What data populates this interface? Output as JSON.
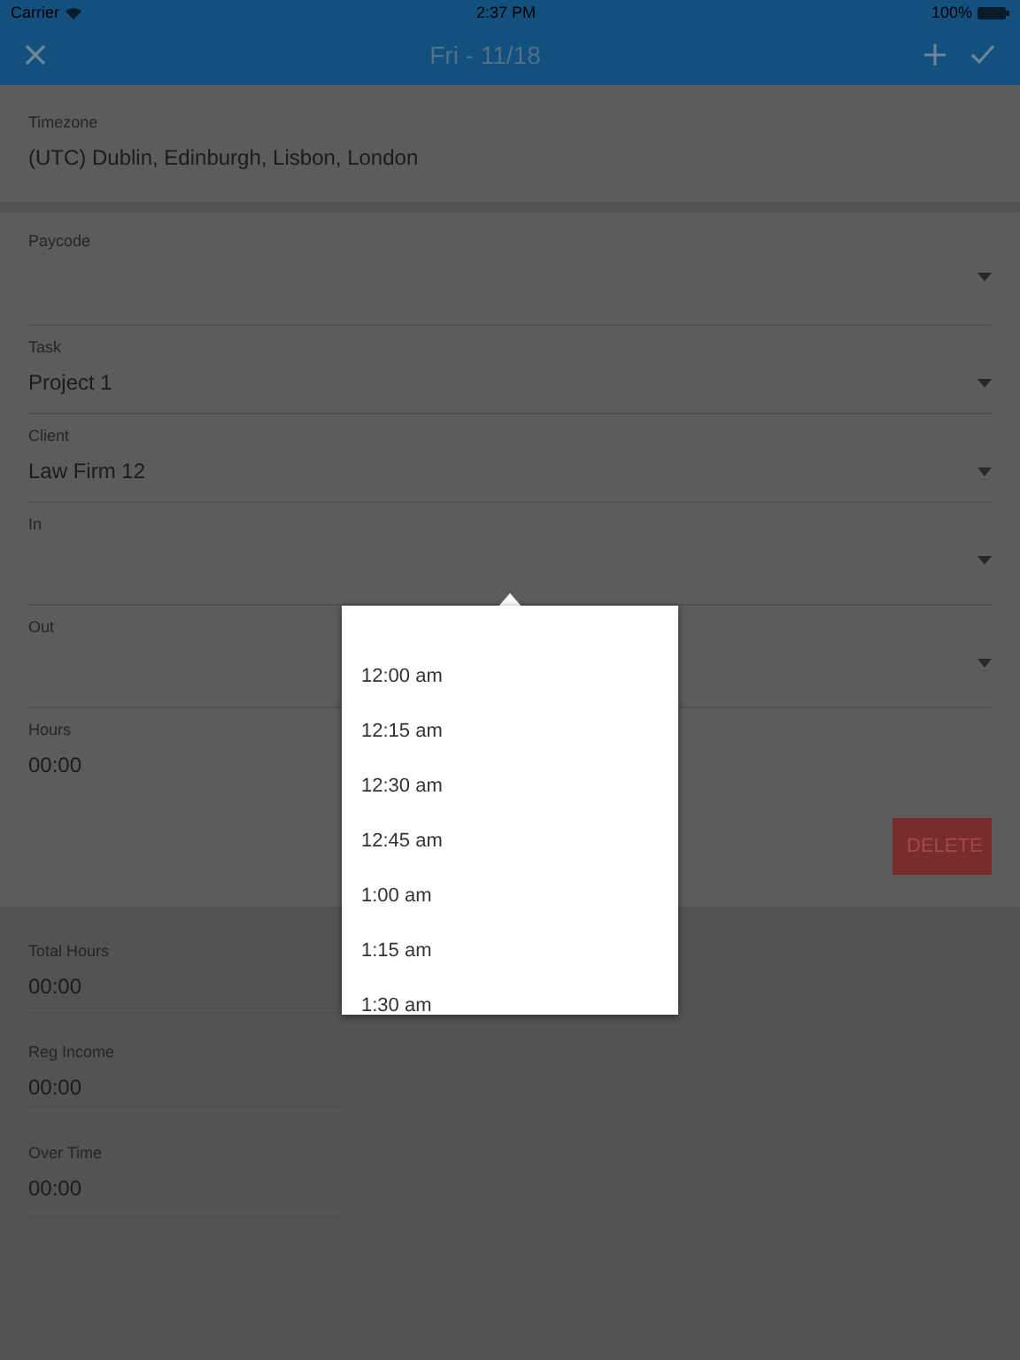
{
  "status_bar": {
    "carrier": "Carrier",
    "time": "2:37 PM",
    "battery": "100%"
  },
  "header": {
    "title": "Fri - 11/18"
  },
  "timezone": {
    "label": "Timezone",
    "value": "(UTC) Dublin, Edinburgh, Lisbon, London"
  },
  "fields": [
    {
      "kind": "select",
      "label": "Paycode"
    },
    {
      "kind": "select",
      "label": "Task",
      "value": "Project 1"
    },
    {
      "kind": "select",
      "label": "Client",
      "value": "Law Firm 12"
    },
    {
      "kind": "select",
      "label": "In"
    },
    {
      "kind": "select",
      "label": "Out"
    },
    {
      "kind": "text",
      "label": "Hours",
      "value": "00:00"
    }
  ],
  "delete_button": "DELETE",
  "summary": [
    {
      "label": "Total Hours",
      "value": "00:00"
    },
    {
      "label": "Reg Income",
      "value": "00:00"
    },
    {
      "label": "Over Time",
      "value": "00:00"
    }
  ],
  "time_menu": {
    "options": [
      "12:00 am",
      "12:15 am",
      "12:30 am",
      "12:45 am",
      "1:00 am",
      "1:15 am",
      "1:30 am"
    ]
  }
}
